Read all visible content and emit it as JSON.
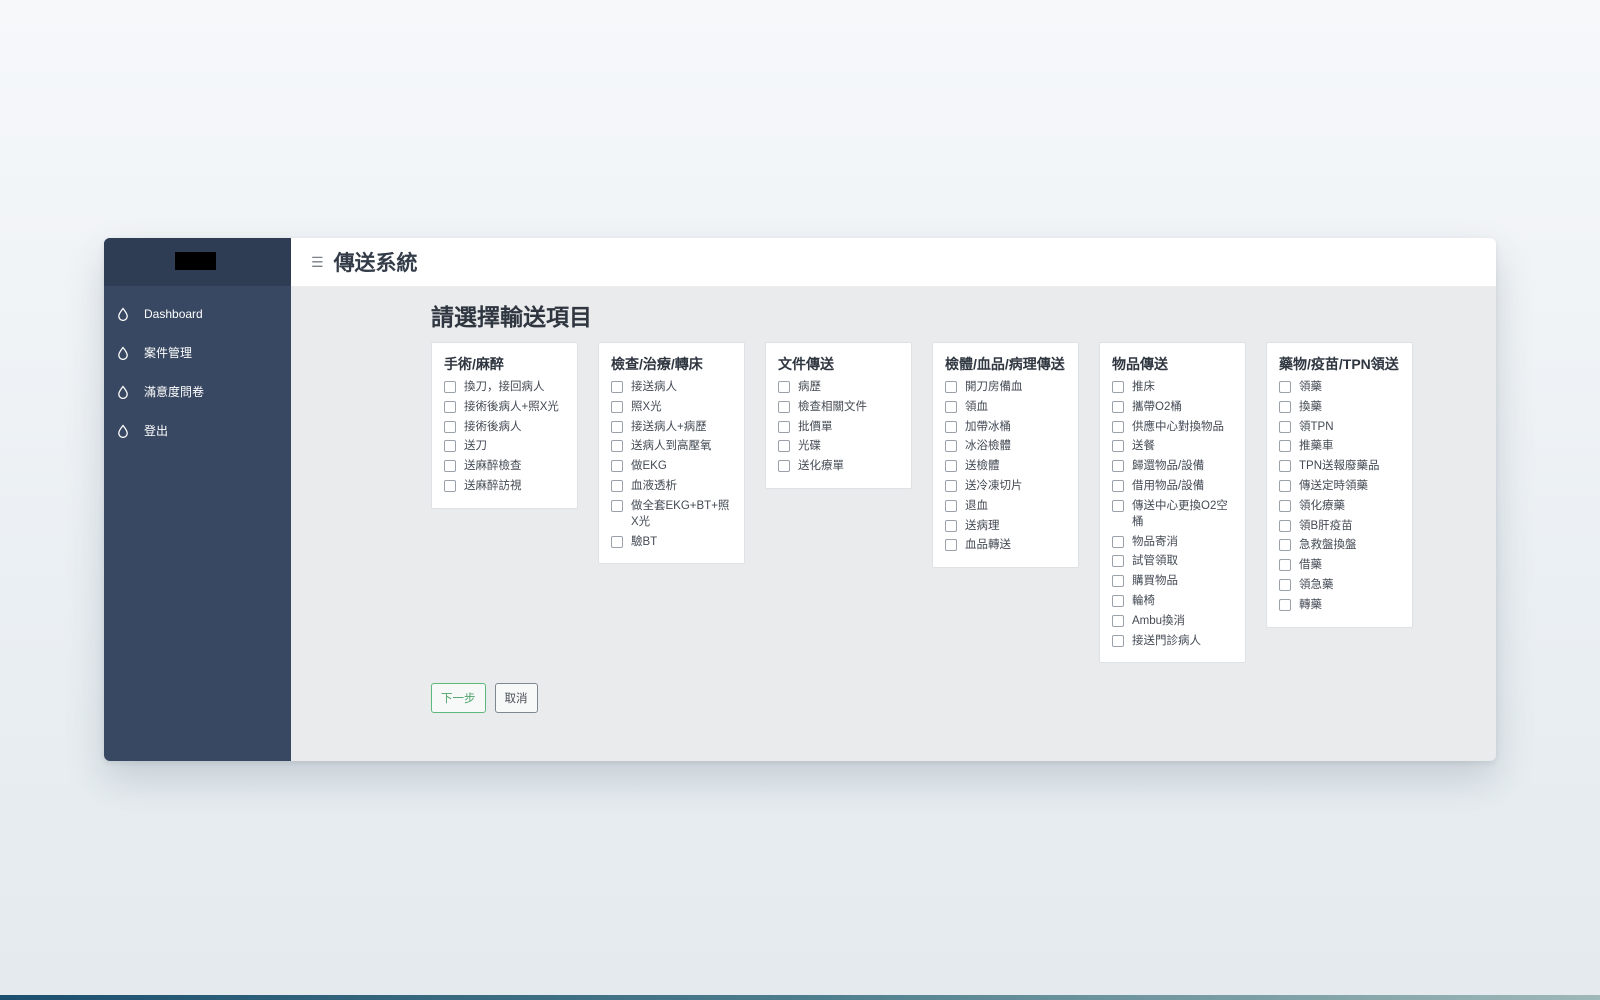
{
  "sidebar": {
    "items": [
      {
        "label": "Dashboard",
        "icon": "droplet-icon"
      },
      {
        "label": "案件管理",
        "icon": "droplet-icon"
      },
      {
        "label": "滿意度問卷",
        "icon": "droplet-icon"
      },
      {
        "label": "登出",
        "icon": "droplet-icon"
      }
    ]
  },
  "header": {
    "title": "傳送系統"
  },
  "main": {
    "page_title": "請選擇輸送項目",
    "categories": [
      {
        "title": "手術/麻醉",
        "options": [
          "換刀，接回病人",
          "接術後病人+照X光",
          "接術後病人",
          "送刀",
          "送麻醉檢查",
          "送麻醉訪視"
        ]
      },
      {
        "title": "檢查/治療/轉床",
        "options": [
          "接送病人",
          "照X光",
          "接送病人+病歷",
          "送病人到高壓氧",
          "做EKG",
          "血液透析",
          "做全套EKG+BT+照X光",
          "驗BT"
        ]
      },
      {
        "title": "文件傳送",
        "options": [
          "病歷",
          "檢查相關文件",
          "批價單",
          "光碟",
          "送化療單"
        ]
      },
      {
        "title": "檢體/血品/病理傳送",
        "options": [
          "開刀房備血",
          "領血",
          "加帶冰桶",
          "冰浴檢體",
          "送檢體",
          "送冷凍切片",
          "退血",
          "送病理",
          "血品轉送"
        ]
      },
      {
        "title": "物品傳送",
        "options": [
          "推床",
          "攜帶O2桶",
          "供應中心對換物品",
          "送餐",
          "歸還物品/設備",
          "借用物品/設備",
          "傳送中心更換O2空桶",
          "物品寄消",
          "試管領取",
          "購買物品",
          "輪椅",
          "Ambu換消",
          "接送門診病人"
        ]
      },
      {
        "title": "藥物/疫苗/TPN領送",
        "options": [
          "領藥",
          "換藥",
          "領TPN",
          "推藥車",
          "TPN送報廢藥品",
          "傳送定時領藥",
          "領化療藥",
          "領B肝疫苗",
          "急救盤換盤",
          "借藥",
          "領急藥",
          "轉藥"
        ]
      }
    ],
    "buttons": {
      "next": "下一步",
      "cancel": "取消"
    }
  },
  "colors": {
    "sidebar_bg": "#384862",
    "sidebar_top": "#2f3d54",
    "next_accent": "#5cb97a"
  }
}
